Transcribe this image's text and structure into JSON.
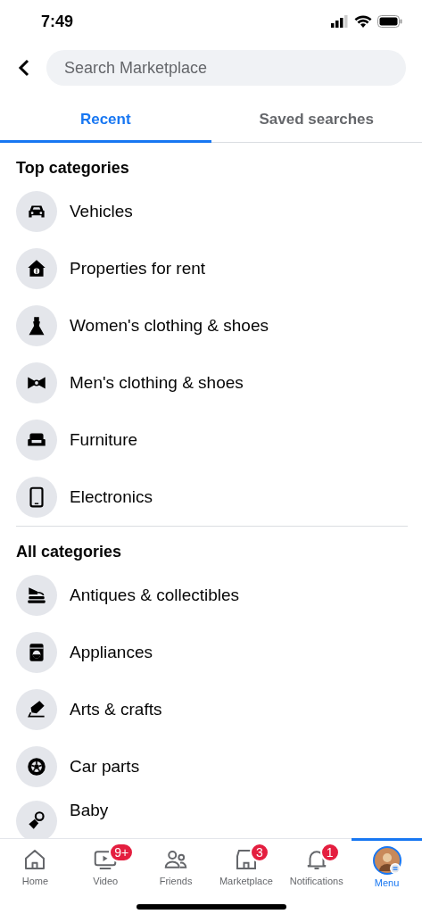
{
  "status_bar": {
    "time": "7:49"
  },
  "search": {
    "placeholder": "Search Marketplace"
  },
  "tabs": [
    {
      "label": "Recent",
      "selected": true
    },
    {
      "label": "Saved searches",
      "selected": false
    }
  ],
  "sections": [
    {
      "title": "Top categories",
      "items": [
        {
          "label": "Vehicles"
        },
        {
          "label": "Properties for rent"
        },
        {
          "label": "Women's clothing & shoes"
        },
        {
          "label": "Men's clothing & shoes"
        },
        {
          "label": "Furniture"
        },
        {
          "label": "Electronics"
        }
      ]
    },
    {
      "title": "All categories",
      "items": [
        {
          "label": "Antiques & collectibles"
        },
        {
          "label": "Appliances"
        },
        {
          "label": "Arts & crafts"
        },
        {
          "label": "Car parts"
        },
        {
          "label": "Baby"
        }
      ]
    }
  ],
  "nav": [
    {
      "label": "Home",
      "selected": false
    },
    {
      "label": "Video",
      "badge": "9+",
      "selected": false
    },
    {
      "label": "Friends",
      "selected": false
    },
    {
      "label": "Marketplace",
      "badge": "3",
      "selected": false
    },
    {
      "label": "Notifications",
      "badge": "1",
      "selected": false
    },
    {
      "label": "Menu",
      "selected": true
    }
  ]
}
